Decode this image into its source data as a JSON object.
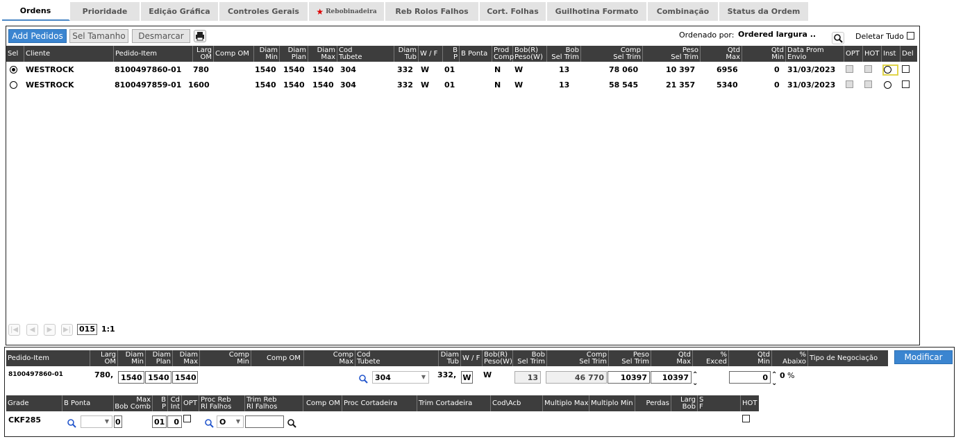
{
  "tabs": [
    "Ordens",
    "Prioridade",
    "Edição Gráfica",
    "Controles Gerais",
    "Rebobinadeira",
    "Reb Rolos Falhos",
    "Cort. Folhas",
    "Guilhotina Formato",
    "Combinação",
    "Status da Ordem"
  ],
  "toolbar": {
    "add_label": "Add Pedidos",
    "sel_tamanho_label": "Sel Tamanho",
    "desmarcar_label": "Desmarcar",
    "ordenado_label": "Ordenado por:",
    "ordenado_value": "Ordered largura ..",
    "deletar_label": "Deletar Tudo"
  },
  "orders_table": {
    "headers": {
      "sel": "Sel",
      "cliente": "Cliente",
      "pedido": "Pedido-Item",
      "larg1": "Larg",
      "larg2": "OM",
      "comp_om": "Comp OM",
      "dmin1": "Diam",
      "dmin2": "Min",
      "dplan1": "Diam",
      "dplan2": "Plan",
      "dmax1": "Diam",
      "dmax2": "Max",
      "cod1": "Cod",
      "cod2": "Tubete",
      "dtub1": "Diam",
      "dtub2": "Tub",
      "wf": "W / F",
      "bp1": "B",
      "bp2": "P",
      "bponta": "B Ponta",
      "prod1": "Prod",
      "prod2": "Comp",
      "bob1": "Bob(R)",
      "bob2": "Peso(W)",
      "bobs1": "Bob",
      "bobs2": "Sel Trim",
      "comp1": "Comp",
      "comp2": "Sel Trim",
      "peso1": "Peso",
      "peso2": "Sel Trim",
      "qmax1": "Qtd",
      "qmax2": "Max",
      "qmin1": "Qtd",
      "qmin2": "Min",
      "data1": "Data Prom",
      "data2": "Envio",
      "opt": "OPT",
      "hot": "HOT",
      "inst": "Inst",
      "del": "Del"
    },
    "rows": [
      {
        "cliente": "WESTROCK",
        "pedido": "8100497860-01",
        "larg": "780",
        "dmin": "1540",
        "dplan": "1540",
        "dmax": "1540",
        "cod": "304",
        "dtub": "332",
        "wf": "W",
        "bp": "01",
        "prod": "N",
        "bob": "W",
        "bobs": "13",
        "comp": "78 060",
        "peso": "10 397",
        "qmax": "6956",
        "qmin": "0",
        "data": "31/03/2023"
      },
      {
        "cliente": "WESTROCK",
        "pedido": "8100497859-01",
        "larg": "1600",
        "dmin": "1540",
        "dplan": "1540",
        "dmax": "1540",
        "cod": "304",
        "dtub": "332",
        "wf": "W",
        "bp": "01",
        "prod": "N",
        "bob": "W",
        "bobs": "13",
        "comp": "58 545",
        "peso": "21 357",
        "qmax": "5340",
        "qmin": "0",
        "data": "31/03/2023"
      }
    ]
  },
  "pagination": {
    "page": "015",
    "ratio": "1:1"
  },
  "detail": {
    "headers": {
      "pedido": "Pedido-Item",
      "larg1": "Larg",
      "larg2": "OM",
      "dmin1": "Diam",
      "dmin2": "Min",
      "dplan1": "Diam",
      "dplan2": "Plan",
      "dmax1": "Diam",
      "dmax2": "Max",
      "cmin1": "Comp",
      "cmin2": "Min",
      "comp_om": "Comp OM",
      "cmax1": "Comp",
      "cmax2": "Max",
      "cod1": "Cod",
      "cod2": "Tubete",
      "dtub1": "Diam",
      "dtub2": "Tub",
      "wf": "W / F",
      "bob1": "Bob(R)",
      "bob2": "Peso(W)",
      "bobs1": "Bob",
      "bobs2": "Sel Trim",
      "comp1": "Comp",
      "comp2": "Sel Trim",
      "peso1": "Peso",
      "peso2": "Sel Trim",
      "qmax1": "Qtd",
      "qmax2": "Max",
      "exc1": "%",
      "exc2": "Exced",
      "qmin1": "Qtd",
      "qmin2": "Min",
      "ab1": "%",
      "ab2": "Abaixo",
      "neg": "Tipo de Negociação"
    },
    "modificar_label": "Modificar",
    "pedido": "8100497860-01",
    "larg": "780,",
    "dmin": "1540",
    "dplan": "1540",
    "dmax": "1540",
    "cod": "304",
    "dtub": "332,",
    "wf": "W",
    "bob": "W",
    "bobs": "13",
    "comp": "46 770",
    "peso": "10397",
    "qmax": "10397",
    "qmin": "0",
    "pct_val": "0",
    "pct": "%"
  },
  "grade": {
    "headers": {
      "grade": "Grade",
      "bponta": "B Ponta",
      "max1": "Max",
      "max2": "Bob Comb",
      "bp1": "B",
      "bp2": "P",
      "cd1": "Cd",
      "cd2": "Int",
      "opt": "OPT",
      "proc1": "Proc Reb",
      "proc2": "Rl Falhos",
      "trim1": "Trim Reb",
      "trim2": "Rl Falhos",
      "comp_om": "Comp OM",
      "proc_cort": "Proc Cortadeira",
      "trim_cort": "Trim Cortadeira",
      "cod_acb": "Cod\\Acb",
      "mult_max": "Multiplo Max",
      "mult_min": "Multiplo Min",
      "perdas": "Perdas",
      "larg1": "Larg",
      "larg2": "Bob",
      "sf1": "S",
      "sf2": "F",
      "hot": "HOT"
    },
    "grade": "CKF285",
    "max": "0",
    "bp": "01",
    "cd": "0",
    "proc": "O"
  },
  "colors": {
    "accent": "#3b85d0",
    "header_bg": "#3d3d3d",
    "star": "#dd0000"
  }
}
